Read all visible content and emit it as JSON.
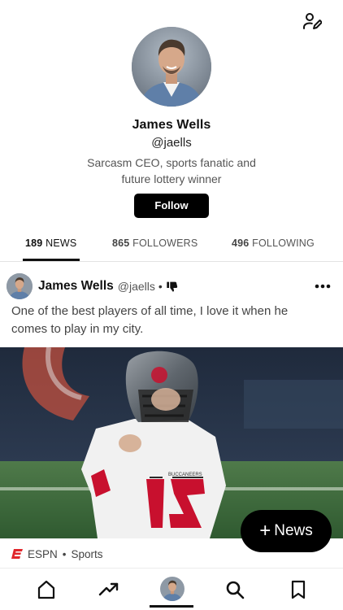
{
  "profile": {
    "name": "James Wells",
    "handle": "@jaells",
    "bio": "Sarcasm CEO, sports fanatic and future lottery winner",
    "follow_label": "Follow"
  },
  "tabs": [
    {
      "count": "189",
      "label": "NEWS",
      "active": true
    },
    {
      "count": "865",
      "label": "FOLLOWERS",
      "active": false
    },
    {
      "count": "496",
      "label": "FOLLOWING",
      "active": false
    }
  ],
  "post": {
    "author_name": "James Wells",
    "author_handle": "@jaells",
    "separator": "•",
    "text": "One of the best players of all time, I love it when he comes to play in my city.",
    "jersey_number": "12",
    "jersey_text": "BUCCANEERS",
    "source_name": "ESPN",
    "source_separator": "•",
    "category": "Sports"
  },
  "fab": {
    "plus": "+",
    "label": "News"
  },
  "colors": {
    "accent": "#000000",
    "espn_red": "#e0262b"
  },
  "icons": {
    "edit": "edit-profile-icon",
    "thumb": "thumbs-down-icon",
    "more": "more-icon",
    "home": "home-icon",
    "trending": "trending-icon",
    "search": "search-icon",
    "bookmark": "bookmark-icon"
  }
}
